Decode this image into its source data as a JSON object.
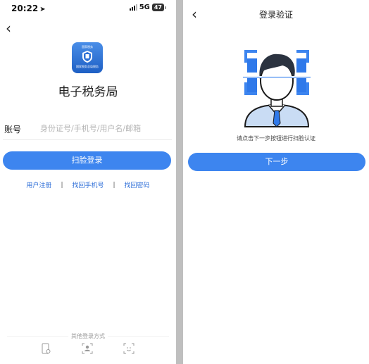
{
  "left": {
    "status": {
      "time": "20:22",
      "network": "5G",
      "battery": "47"
    },
    "logo": {
      "top_text": "国家税务",
      "sub_text": "国家税务总局税务"
    },
    "app_title": "电子税务局",
    "account": {
      "label": "账号",
      "placeholder": "身份证号/手机号/用户名/邮箱",
      "value": ""
    },
    "face_login_label": "扫脸登录",
    "links": {
      "register": "用户注册",
      "sep": "|",
      "recover_phone": "找回手机号",
      "recover_password": "找回密码"
    },
    "other_login_label": "其他登录方式",
    "icons": {
      "back": "chevron-left-icon",
      "alt_login": [
        "phone-login-icon",
        "id-card-login-icon",
        "face-scan-icon"
      ]
    }
  },
  "right": {
    "title": "登录验证",
    "hint": "请点击下一步按钮进行扫脸认证",
    "next_label": "下一步"
  },
  "colors": {
    "accent": "#3d85ef",
    "link": "#2f6fd8",
    "divider": "#bfbfbf"
  }
}
